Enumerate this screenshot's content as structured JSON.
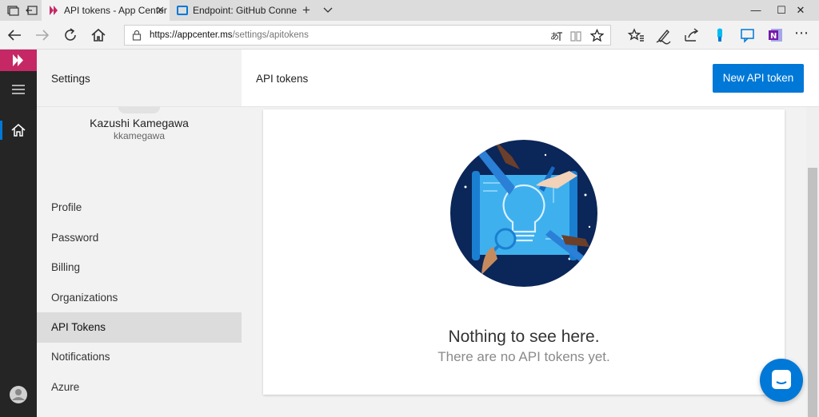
{
  "browser": {
    "tabs": [
      {
        "title": "API tokens - App Center",
        "active": true
      },
      {
        "title": "Endpoint: GitHub Connectio",
        "active": false
      }
    ],
    "address": {
      "host": "https://appcenter.ms",
      "path": "/settings/apitokens"
    }
  },
  "sidebar": {
    "header": "Settings",
    "user": {
      "name": "Kazushi Kamegawa",
      "handle": "kkamegawa"
    },
    "items": [
      {
        "label": "Profile"
      },
      {
        "label": "Password"
      },
      {
        "label": "Billing"
      },
      {
        "label": "Organizations"
      },
      {
        "label": "API Tokens",
        "selected": true
      },
      {
        "label": "Notifications"
      },
      {
        "label": "Azure"
      }
    ]
  },
  "main": {
    "title": "API tokens",
    "new_button": "New API token",
    "empty_title": "Nothing to see here.",
    "empty_subtitle": "There are no API tokens yet."
  },
  "colors": {
    "accent": "#0078d7",
    "brand": "#c52865",
    "rail": "#252525"
  },
  "icons": [
    "tab-manager-icon",
    "back-tabs-icon",
    "close-icon",
    "new-tab-icon",
    "chevron-down-icon",
    "minimize-icon",
    "maximize-icon",
    "back-icon",
    "forward-icon",
    "refresh-icon",
    "home-icon",
    "lock-icon",
    "translate-icon",
    "reading-view-icon",
    "star-icon",
    "favorites-icon",
    "pen-icon",
    "share-icon",
    "extension-icon",
    "feedback-icon",
    "onenote-icon",
    "more-icon",
    "app-center-logo",
    "hamburger-icon",
    "user-icon",
    "chat-icon"
  ]
}
